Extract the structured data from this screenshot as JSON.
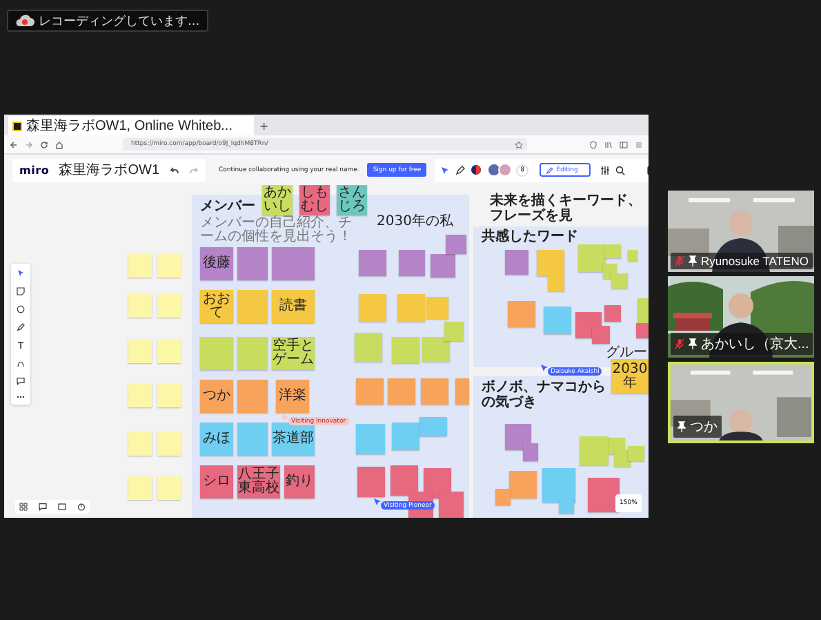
{
  "recording_badge": {
    "label": "レコーディングしています..."
  },
  "shared_screen": {
    "browser": {
      "tab_title": "森里海ラボOW1, Online Whiteb...",
      "new_tab": "+",
      "url": "https://miro.com/app/board/o9J_lqdhM8TRn/"
    },
    "toolbar": {
      "logo": "miro",
      "board_name": "森里海ラボOW1",
      "banner": "Continue collaborating using your real name.",
      "signup_button": "Sign up for free",
      "collaborator_count": "8",
      "mode_button": "Editing"
    },
    "board": {
      "frames": [
        {
          "title": "メンバー",
          "subtitle": "メンバーの自己紹介、チームの個性を見出そう！"
        },
        {
          "title": "共感したワード"
        },
        {
          "title": "ボノボ、ナマコからの気づき"
        }
      ],
      "labels": [
        {
          "text": "2030年の私",
          "kind": "small"
        },
        {
          "text": "未来を描くキーワード、フレーズを見",
          "kind": "heading"
        },
        {
          "text": "グルー",
          "kind": "small"
        }
      ],
      "notes": [
        {
          "text": "あかいし",
          "color": "#c8dd60"
        },
        {
          "text": "しもむし",
          "color": "#e7697f"
        },
        {
          "text": "さんじろ",
          "color": "#6cc8bd"
        },
        {
          "text": "後藤",
          "color": "#b584c8"
        },
        {
          "color": "#b584c8"
        },
        {
          "color": "#b584c8"
        },
        {
          "text": "おおて",
          "color": "#f4c842"
        },
        {
          "color": "#f4c842"
        },
        {
          "text": "読書",
          "color": "#f4c842"
        },
        {
          "color": "#c8dd60"
        },
        {
          "color": "#c8dd60"
        },
        {
          "text": "空手とゲーム",
          "color": "#c8dd60"
        },
        {
          "text": "つか",
          "color": "#f7a35c"
        },
        {
          "color": "#f7a35c"
        },
        {
          "text": "洋楽",
          "color": "#f7a35c"
        },
        {
          "text": "みほ",
          "color": "#6fcff2"
        },
        {
          "color": "#6fcff2"
        },
        {
          "text": "茶道部",
          "color": "#6fcff2"
        },
        {
          "text": "シロ",
          "color": "#e7697f"
        },
        {
          "text": "八王子東高校",
          "color": "#e7697f"
        },
        {
          "text": "釣り",
          "color": "#e7697f"
        },
        {
          "color": "#fcf6a7"
        },
        {
          "color": "#fcf6a7"
        },
        {
          "color": "#fcf6a7"
        },
        {
          "color": "#fcf6a7"
        },
        {
          "color": "#fcf6a7"
        },
        {
          "color": "#fcf6a7"
        },
        {
          "color": "#fcf6a7"
        },
        {
          "color": "#fcf6a7"
        },
        {
          "color": "#fcf6a7"
        },
        {
          "color": "#fcf6a7"
        },
        {
          "color": "#fcf6a7"
        },
        {
          "color": "#fcf6a7"
        },
        {
          "color": "#b584c8"
        },
        {
          "color": "#b584c8"
        },
        {
          "color": "#b584c8"
        },
        {
          "color": "#b584c8"
        },
        {
          "color": "#f4c842"
        },
        {
          "color": "#f4c842"
        },
        {
          "color": "#f4c842"
        },
        {
          "color": "#c8dd60"
        },
        {
          "color": "#c8dd60"
        },
        {
          "color": "#c8dd60"
        },
        {
          "color": "#c8dd60"
        },
        {
          "color": "#f7a35c"
        },
        {
          "color": "#f7a35c"
        },
        {
          "color": "#f7a35c"
        },
        {
          "color": "#f7a35c"
        },
        {
          "color": "#6fcff2"
        },
        {
          "color": "#6fcff2"
        },
        {
          "color": "#6fcff2"
        },
        {
          "color": "#e7697f"
        },
        {
          "color": "#e7697f"
        },
        {
          "color": "#e7697f"
        },
        {
          "color": "#e7697f"
        },
        {
          "color": "#e7697f"
        },
        {
          "color": "#b584c8"
        },
        {
          "color": "#f4c842"
        },
        {
          "color": "#f4c842"
        },
        {
          "color": "#c8dd60"
        },
        {
          "color": "#c8dd60"
        },
        {
          "color": "#c8dd60"
        },
        {
          "color": "#c8dd60"
        },
        {
          "color": "#c8dd60"
        },
        {
          "color": "#f7a35c"
        },
        {
          "color": "#6fcff2"
        },
        {
          "color": "#e7697f"
        },
        {
          "color": "#e7697f"
        },
        {
          "color": "#e7697f"
        },
        {
          "color": "#c8dd60"
        },
        {
          "color": "#e7697f"
        },
        {
          "text": "2030年",
          "color": "#f4c842"
        },
        {
          "color": "#b584c8"
        },
        {
          "color": "#b584c8"
        },
        {
          "color": "#f7a35c"
        },
        {
          "color": "#f7a35c"
        },
        {
          "color": "#6fcff2"
        },
        {
          "color": "#6fcff2"
        },
        {
          "color": "#e7697f"
        },
        {
          "color": "#c8dd60"
        },
        {
          "color": "#c8dd60"
        },
        {
          "color": "#c8dd60"
        },
        {
          "color": "#c8dd60"
        }
      ],
      "cursors": [
        {
          "label": "Visiting Innovator",
          "color": "#f9c6c9"
        },
        {
          "label": "Visiting Pioneer",
          "color": "#4262ff"
        },
        {
          "label": "Daisuke Akaishi",
          "color": "#4262ff"
        }
      ],
      "zoom": "150%"
    }
  },
  "participants": [
    {
      "name": "Ryunosuke TATENO",
      "muted": true,
      "active": false
    },
    {
      "name": "あかいし（京大...",
      "muted": true,
      "active": false
    },
    {
      "name": "つか",
      "muted": false,
      "active": true
    }
  ]
}
